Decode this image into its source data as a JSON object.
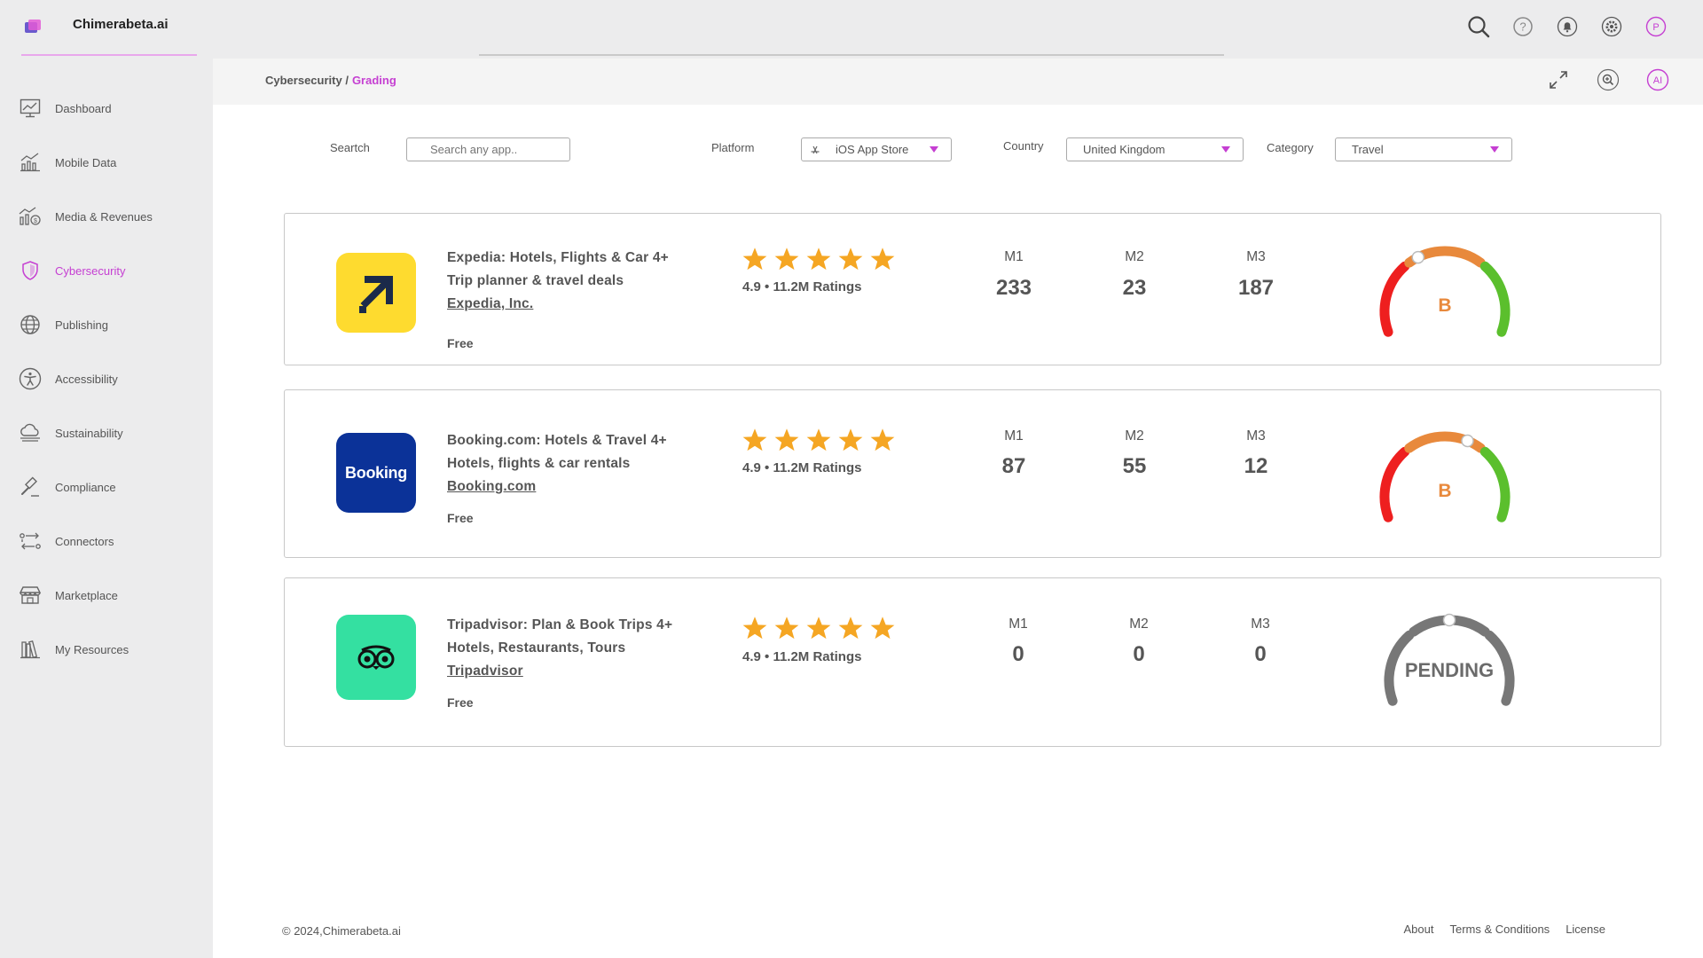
{
  "app": {
    "title": "Chimerabeta.ai"
  },
  "header": {
    "icons": [
      "search-icon",
      "help-icon",
      "bell-icon",
      "gear-icon"
    ],
    "profile_initial": "P"
  },
  "sidebar": {
    "items": [
      {
        "label": "Dashboard",
        "icon": "dashboard-icon",
        "active": false
      },
      {
        "label": "Mobile Data",
        "icon": "bar-chart-icon",
        "active": false
      },
      {
        "label": "Media & Revenues",
        "icon": "revenue-chart-icon",
        "active": false
      },
      {
        "label": "Cybersecurity",
        "icon": "shield-icon",
        "active": true
      },
      {
        "label": "Publishing",
        "icon": "globe-icon",
        "active": false
      },
      {
        "label": "Accessibility",
        "icon": "accessibility-icon",
        "active": false
      },
      {
        "label": "Sustainability",
        "icon": "cloud-icon",
        "active": false
      },
      {
        "label": "Compliance",
        "icon": "gavel-icon",
        "active": false
      },
      {
        "label": "Connectors",
        "icon": "connectors-icon",
        "active": false
      },
      {
        "label": "Marketplace",
        "icon": "store-icon",
        "active": false
      },
      {
        "label": "My Resources",
        "icon": "resources-icon",
        "active": false
      }
    ]
  },
  "breadcrumb": {
    "parent": "Cybersecurity /",
    "current": "Grading",
    "ai_label": "AI"
  },
  "filters": {
    "search": {
      "label": "Seartch",
      "placeholder": "Search any app.."
    },
    "platform": {
      "label": "Platform",
      "value": "iOS App Store"
    },
    "country": {
      "label": "Country",
      "value": "United Kingdom"
    },
    "category": {
      "label": "Category",
      "value": "Travel"
    }
  },
  "apps": [
    {
      "name": "Expedia: Hotels, Flights & Car 4+",
      "subtitle": "Trip planner & travel deals",
      "developer": "Expedia, Inc.",
      "price": "Free",
      "stars": 5,
      "rating": "4.9 • 11.2M Ratings",
      "metrics": [
        {
          "label": "M1",
          "value": "233"
        },
        {
          "label": "M2",
          "value": "23"
        },
        {
          "label": "M3",
          "value": "187"
        }
      ],
      "grade": "B",
      "grade_color": "#e8893c",
      "gauge_position": 0.38,
      "icon_bg": "#fedb2f"
    },
    {
      "name": "Booking.com: Hotels & Travel 4+",
      "subtitle": "Hotels, flights & car rentals",
      "developer": "Booking.com",
      "price": "Free",
      "stars": 5,
      "rating": "4.9 • 11.2M Ratings",
      "metrics": [
        {
          "label": "M1",
          "value": "87"
        },
        {
          "label": "M2",
          "value": "55"
        },
        {
          "label": "M3",
          "value": "12"
        }
      ],
      "grade": "B",
      "grade_color": "#e8893c",
      "gauge_position": 0.6,
      "icon_bg": "#0b3298",
      "icon_text": "Booking"
    },
    {
      "name": "Tripadvisor: Plan & Book Trips 4+",
      "subtitle": "Hotels, Restaurants, Tours",
      "developer": "Tripadvisor",
      "price": "Free",
      "stars": 5,
      "rating": "4.9 • 11.2M Ratings",
      "metrics": [
        {
          "label": "M1",
          "value": "0"
        },
        {
          "label": "M2",
          "value": "0"
        },
        {
          "label": "M3",
          "value": "0"
        }
      ],
      "grade": "PENDING",
      "grade_color": "#6b6b6b",
      "gauge_position": 0.5,
      "icon_bg": "#34e0a1"
    }
  ],
  "colors": {
    "accent": "#c53fd2",
    "star": "#f5a623",
    "gauge_red": "#ee1f1f",
    "gauge_orange": "#e8893c",
    "gauge_green": "#5bbf2d",
    "gauge_pending": "#777777"
  },
  "footer": {
    "copyright": "© 2024,Chimerabeta.ai",
    "links": [
      "About",
      "Terms & Conditions",
      "License"
    ]
  }
}
